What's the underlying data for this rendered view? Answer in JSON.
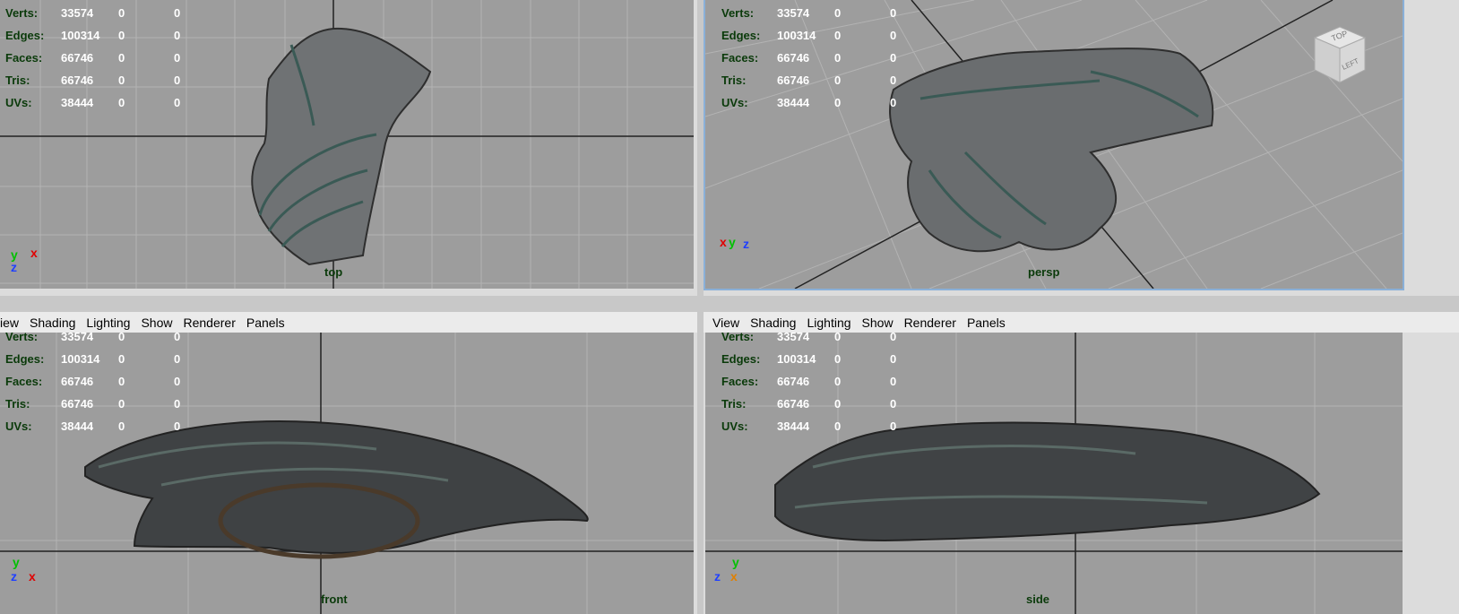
{
  "stats_labels": {
    "verts": "Verts:",
    "edges": "Edges:",
    "faces": "Faces:",
    "tris": "Tris:",
    "uvs": "UVs:"
  },
  "stats_values": {
    "verts": "33574",
    "edges": "100314",
    "faces": "66746",
    "tris": "66746",
    "uvs": "38444",
    "zero": "0"
  },
  "menu": {
    "view_cut": "iew",
    "view": "View",
    "shading": "Shading",
    "lighting": "Lighting",
    "show": "Show",
    "renderer": "Renderer",
    "panels": "Panels"
  },
  "cameras": {
    "top": "top",
    "persp": "persp",
    "front": "front",
    "side": "side"
  },
  "viewcube": {
    "top": "TOP",
    "left": "LEFT"
  },
  "axes": {
    "x": "x",
    "y": "y",
    "z": "z"
  },
  "colors": {
    "viewport_bg": "#9d9d9d",
    "grid": "#b0b0b0",
    "stats_label": "#0a3a0a",
    "axis_x": "#e00000",
    "axis_y": "#00c000",
    "axis_z": "#2040ff"
  }
}
